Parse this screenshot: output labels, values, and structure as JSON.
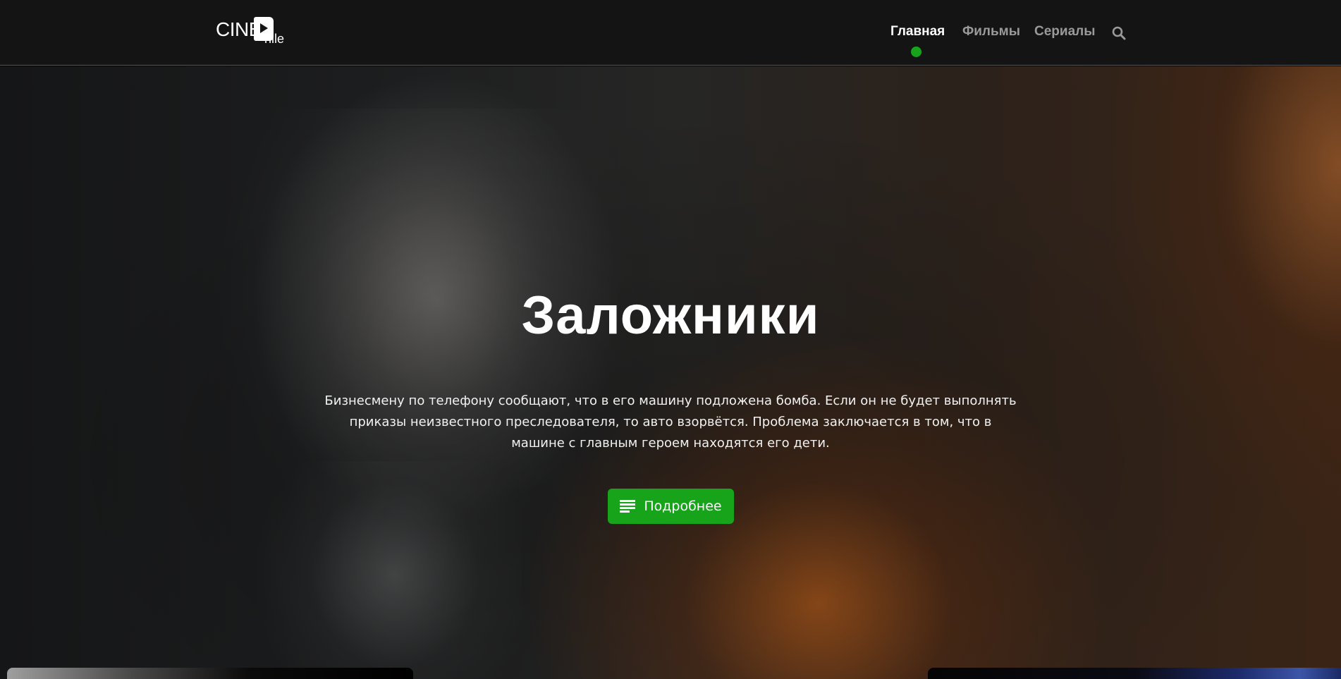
{
  "header": {
    "logo": {
      "cine": "CINE",
      "hile": "hile"
    },
    "nav": [
      {
        "label": "Главная",
        "active": true
      },
      {
        "label": "Фильмы",
        "active": false
      },
      {
        "label": "Сериалы",
        "active": false
      }
    ],
    "search_icon": "search-icon"
  },
  "hero": {
    "title": "Заложники",
    "description": "Бизнесмену по телефону сообщают, что в его машину подложена бомба. Если он не будет выполнять приказы неизвестного преследователя, то авто взорвётся. Проблема заключается в том, что в машине с главным героем находятся его дети.",
    "button": {
      "label": "Подробнее",
      "icon": "list-icon"
    }
  },
  "colors": {
    "accent": "#17a31a",
    "header_bg": "#141414",
    "nav_inactive": "#9a9a9a",
    "text": "#ffffff"
  }
}
